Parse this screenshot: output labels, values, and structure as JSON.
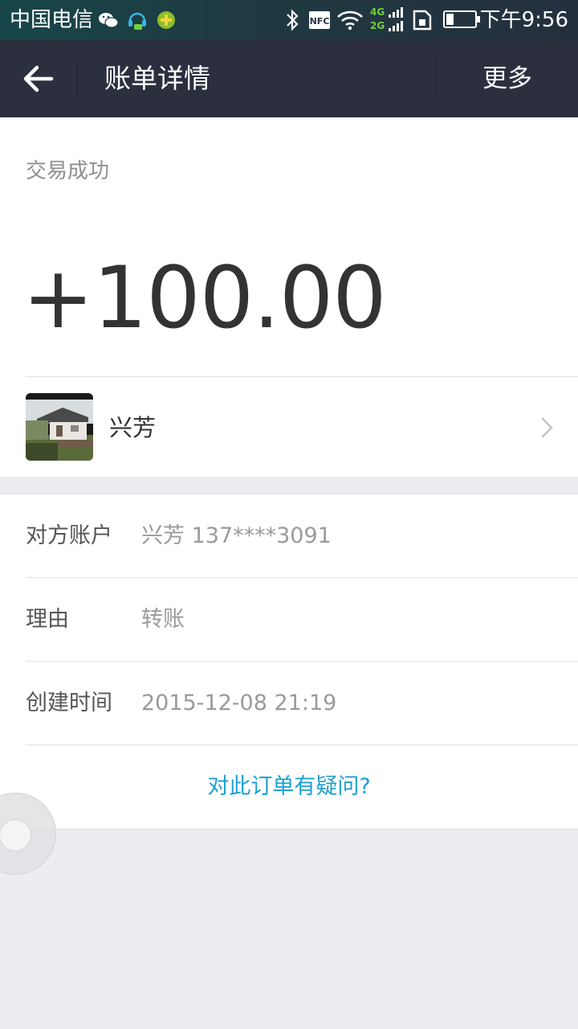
{
  "status_bar": {
    "carrier": "中国电信",
    "nfc_label": "NFC",
    "network_top": "4G",
    "network_bottom": "2G",
    "time": "下午9:56",
    "battery_percent": 25
  },
  "nav": {
    "title": "账单详情",
    "more_label": "更多"
  },
  "transaction": {
    "status": "交易成功",
    "amount": "+100.00",
    "payer_name": "兴芳"
  },
  "details": [
    {
      "label": "对方账户",
      "value": "兴芳 137****3091"
    },
    {
      "label": "理由",
      "value": "转账"
    },
    {
      "label": "创建时间",
      "value": "2015-12-08 21:19"
    }
  ],
  "question_link": "对此订单有疑问?",
  "colors": {
    "nav_background": "#2b2f3e",
    "link": "#1ea0d2",
    "page_background": "#ebedf1"
  }
}
